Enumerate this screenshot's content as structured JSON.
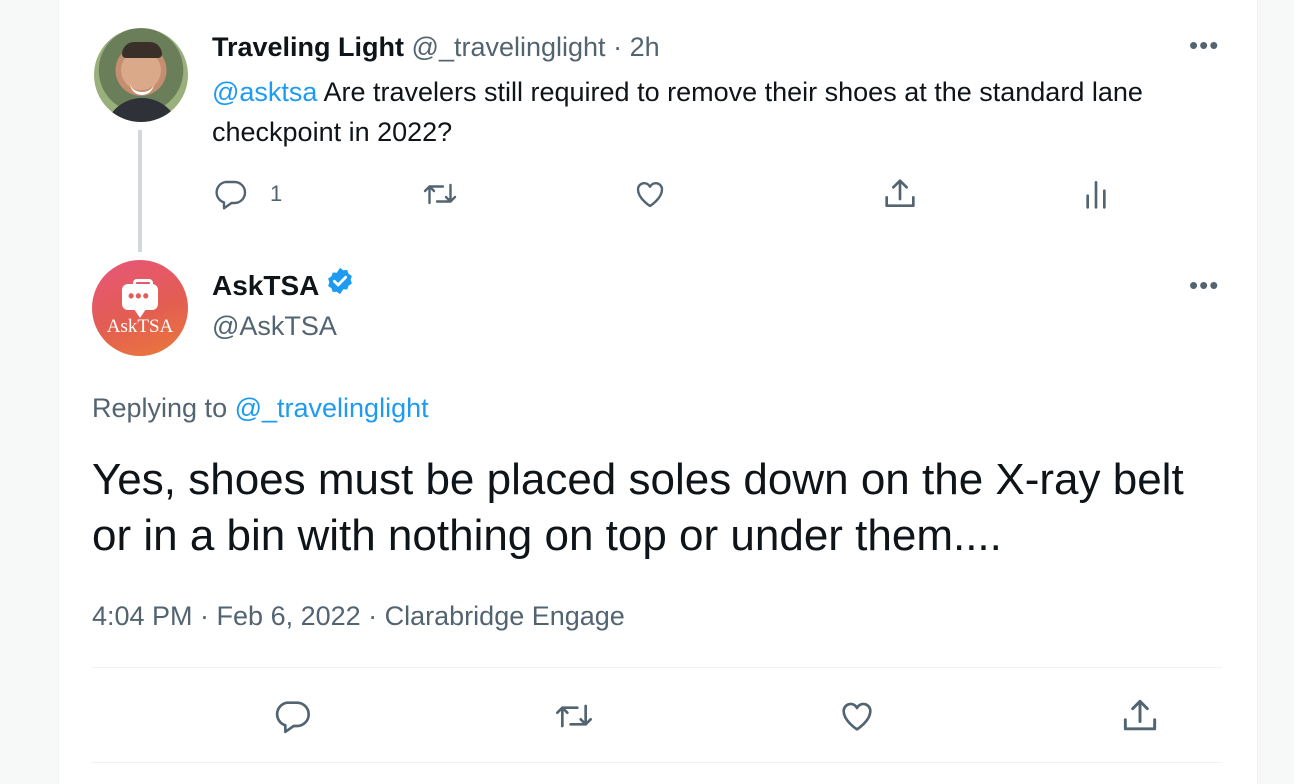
{
  "tweet1": {
    "display_name": "Traveling Light",
    "handle": "@_travelinglight",
    "separator": "·",
    "time_ago": "2h",
    "more_label": "•••",
    "mention": "@asktsa",
    "text": " Are travelers still required to remove their shoes at the standard lane checkpoint in 2022?",
    "reply_count": "1",
    "icons": [
      "reply-icon",
      "retweet-icon",
      "like-icon",
      "share-icon",
      "analytics-icon"
    ]
  },
  "tweet2": {
    "display_name": "AskTSA",
    "verified": true,
    "handle": "@AskTSA",
    "more_label": "•••",
    "avatar_brand": "AskTSA",
    "avatar_dots": "•••",
    "replying_prefix": "Replying to ",
    "replying_to": "@_travelinglight",
    "text": "Yes, shoes must be placed soles down on the X-ray belt or in a bin with nothing on top or under them....",
    "timestamp": "4:04 PM · Feb 6, 2022 · Clarabridge Engage",
    "icons": [
      "reply-icon",
      "retweet-icon",
      "like-icon",
      "share-icon"
    ]
  },
  "colors": {
    "accent": "#1d9bf0",
    "muted": "#536471",
    "text": "#0f1419",
    "thread_line": "#cfd9de",
    "asktsa_gradient": [
      "#e8567a",
      "#ea7a3a"
    ]
  }
}
